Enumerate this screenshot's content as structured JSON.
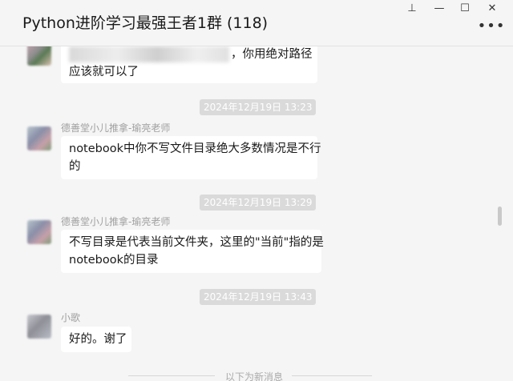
{
  "window": {
    "title": "Python进阶学习最强王者1群 (118)",
    "more_glyph": "•••",
    "pin_glyph": "⊥",
    "minimize_glyph": "—",
    "maximize_glyph": "☐",
    "close_glyph": "✕"
  },
  "messages": [
    {
      "avatar_icon": "blurred-user-avatar",
      "lines": [
        "，你用绝对路径",
        "应该就可以了"
      ]
    },
    {
      "sender": "德善堂小儿推拿-瑜亮老师",
      "lines": [
        "notebook中你不写文件目录绝大多数情况是不行",
        "的"
      ]
    },
    {
      "sender": "德善堂小儿推拿-瑜亮老师",
      "lines": [
        "不写目录是代表当前文件夹，这里的\"当前\"指的是",
        "notebook的目录"
      ]
    },
    {
      "sender": "小歌",
      "lines": [
        "好的。谢了"
      ]
    }
  ],
  "timestamps": [
    "2024年12月19日 13:23",
    "2024年12月19日 13:29",
    "2024年12月19日 13:43"
  ],
  "divider": "以下为新消息",
  "colors": {
    "bg": "#f5f5f5",
    "bubble": "#ffffff",
    "pill": "#dadada",
    "sender": "#a0a0a0"
  }
}
